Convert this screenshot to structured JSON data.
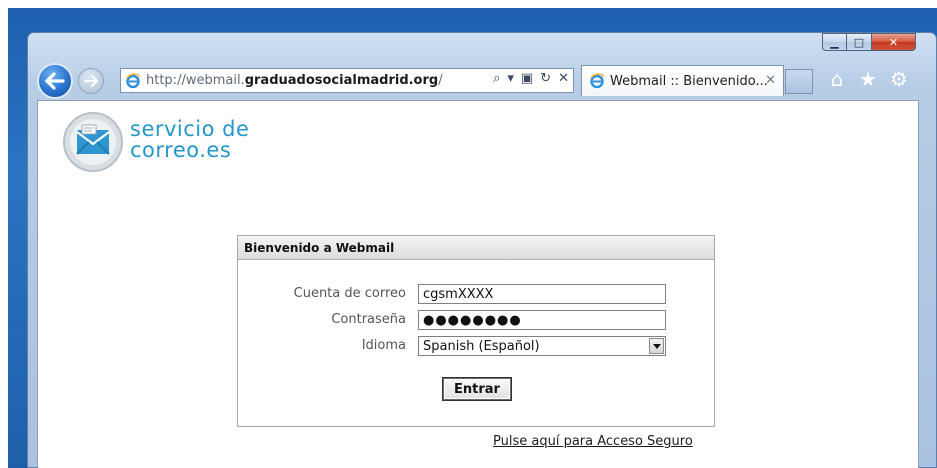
{
  "browser": {
    "window_controls": {
      "minimize": "▁",
      "maximize": "□",
      "close": "✕"
    },
    "address_bar": {
      "url_prefix": "http://webmail.",
      "url_domain": "graduadosocialmadrid.org",
      "url_suffix": "/",
      "actions": {
        "search": "⌕",
        "dropdown": "▾",
        "compat": "▣",
        "refresh": "↻",
        "stop": "✕"
      }
    },
    "tab": {
      "title": "Webmail :: Bienvenido...",
      "close": "✕"
    },
    "tools": {
      "home": "⌂",
      "favorites": "★",
      "settings": "⚙"
    },
    "icons": {
      "back": "back-arrow-icon",
      "forward": "forward-arrow-icon",
      "page": "ie-icon"
    }
  },
  "logo": {
    "line1": "servicio de",
    "line2": "correo.es"
  },
  "login": {
    "header": "Bienvenido a Webmail",
    "fields": [
      {
        "label": "Cuenta de correo",
        "value": "cgsmXXXX"
      },
      {
        "label": "Contraseña",
        "value": "●●●●●●●●"
      },
      {
        "label": "Idioma",
        "value": "Spanish (Español)"
      }
    ],
    "submit_label": "Entrar"
  },
  "secure_link": "Pulse aquí para Acceso Seguro",
  "colors": {
    "accent": "#2496c9",
    "titlebar": "#b7cde6",
    "desktop": "#1d5fae"
  }
}
